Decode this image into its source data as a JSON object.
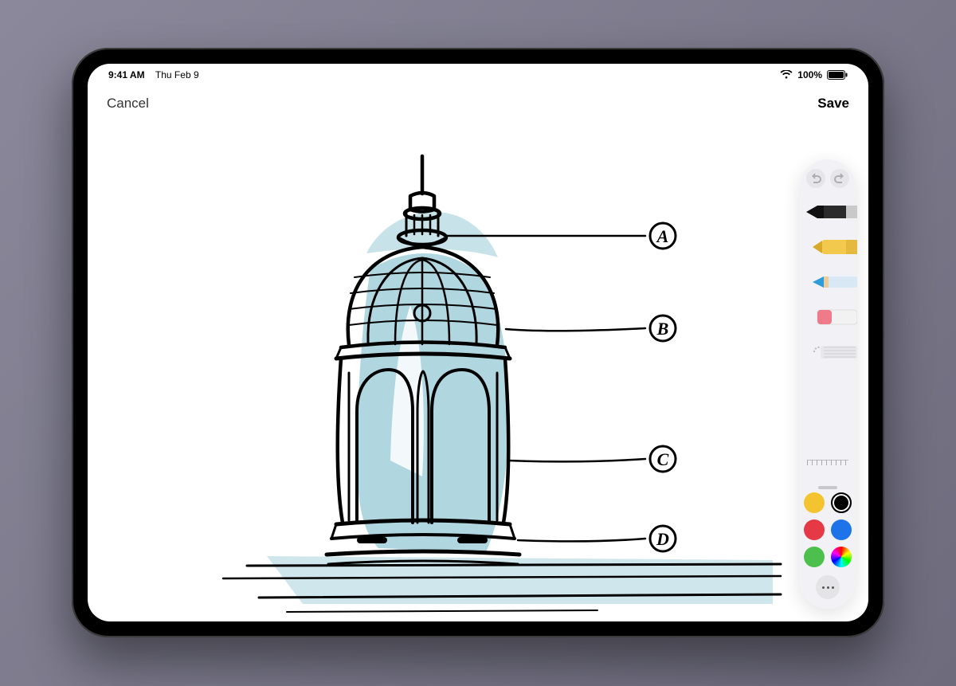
{
  "statusbar": {
    "time": "9:41 AM",
    "date": "Thu Feb 9",
    "battery_text": "100%"
  },
  "nav": {
    "cancel": "Cancel",
    "save": "Save"
  },
  "annotations": [
    "A",
    "B",
    "C",
    "D"
  ],
  "tools": [
    {
      "id": "pen",
      "selected": true
    },
    {
      "id": "marker",
      "selected": false
    },
    {
      "id": "pencil",
      "selected": false
    },
    {
      "id": "eraser",
      "selected": false
    },
    {
      "id": "lasso",
      "selected": false
    }
  ],
  "colors": {
    "swatches": [
      "#f4c430",
      "#000000",
      "#e63946",
      "#1e73e8",
      "#4cbf4c",
      "wheel"
    ],
    "selected": "#000000"
  },
  "drawing": {
    "ink": "#000000",
    "wash": "#6fb7c6"
  }
}
